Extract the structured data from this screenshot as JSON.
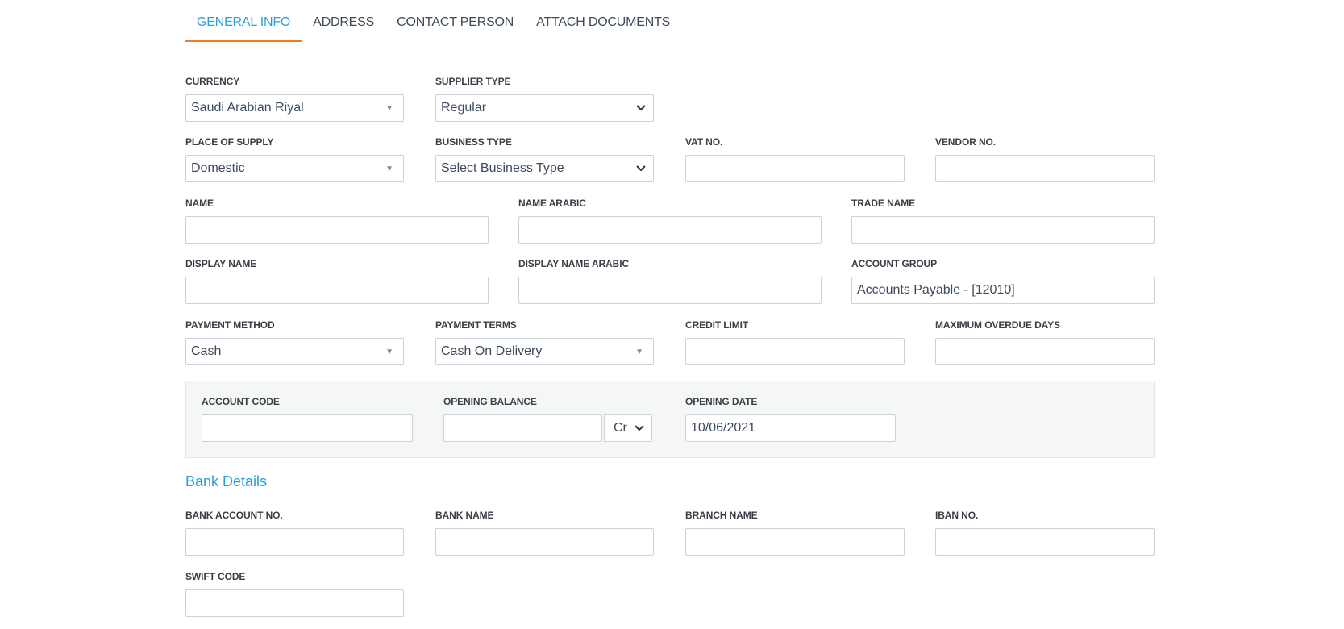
{
  "tabs": [
    {
      "label": "GENERAL INFO",
      "active": true
    },
    {
      "label": "ADDRESS",
      "active": false
    },
    {
      "label": "CONTACT PERSON",
      "active": false
    },
    {
      "label": "ATTACH DOCUMENTS",
      "active": false
    }
  ],
  "colors": {
    "accent": "#2a9fd8",
    "tab_underline": "#f57a20",
    "panel_bg": "#f5f6f6"
  },
  "general": {
    "currency": {
      "label": "CURRENCY",
      "value": "Saudi Arabian Riyal",
      "icon": "caret-down-icon"
    },
    "supplier_type": {
      "label": "SUPPLIER TYPE",
      "value": "Regular",
      "icon": "chevron-down-icon"
    },
    "place_of_supply": {
      "label": "PLACE OF SUPPLY",
      "value": "Domestic",
      "icon": "caret-down-icon"
    },
    "business_type": {
      "label": "BUSINESS TYPE",
      "value": "Select Business Type",
      "icon": "chevron-down-icon"
    },
    "vat_no": {
      "label": "VAT NO.",
      "value": ""
    },
    "vendor_no": {
      "label": "VENDOR NO.",
      "value": ""
    },
    "name": {
      "label": "NAME",
      "value": ""
    },
    "name_arabic": {
      "label": "NAME ARABIC",
      "value": ""
    },
    "trade_name": {
      "label": "TRADE NAME",
      "value": ""
    },
    "display_name": {
      "label": "DISPLAY NAME",
      "value": ""
    },
    "display_name_arabic": {
      "label": "DISPLAY NAME ARABIC",
      "value": ""
    },
    "account_group": {
      "label": "ACCOUNT GROUP",
      "value": "Accounts Payable - [12010]"
    },
    "payment_method": {
      "label": "PAYMENT METHOD",
      "value": "Cash",
      "icon": "caret-down-icon"
    },
    "payment_terms": {
      "label": "PAYMENT TERMS",
      "value": "Cash On Delivery",
      "icon": "caret-down-icon"
    },
    "credit_limit": {
      "label": "CREDIT LIMIT",
      "value": ""
    },
    "max_overdue_days": {
      "label": "MAXIMUM OVERDUE DAYS",
      "value": ""
    }
  },
  "opening": {
    "account_code": {
      "label": "ACCOUNT CODE",
      "value": ""
    },
    "opening_balance": {
      "label": "OPENING BALANCE",
      "value": "",
      "type_value": "Cr"
    },
    "opening_date": {
      "label": "OPENING DATE",
      "value": "10/06/2021"
    }
  },
  "bank": {
    "title": "Bank Details",
    "bank_account_no": {
      "label": "BANK ACCOUNT NO.",
      "value": ""
    },
    "bank_name": {
      "label": "BANK NAME",
      "value": ""
    },
    "branch_name": {
      "label": "BRANCH NAME",
      "value": ""
    },
    "iban_no": {
      "label": "IBAN NO.",
      "value": ""
    },
    "swift_code": {
      "label": "SWIFT CODE",
      "value": ""
    }
  }
}
